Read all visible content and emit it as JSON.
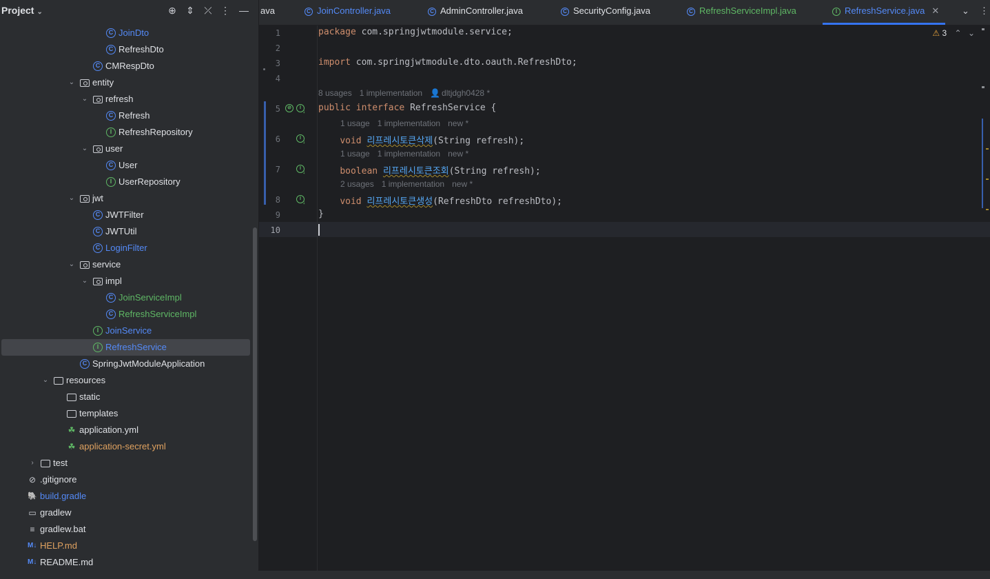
{
  "project": {
    "title": "Project",
    "tree": [
      {
        "label": "JoinDto",
        "icon": "class-icon",
        "color": "blue",
        "depth": 8
      },
      {
        "label": "RefreshDto",
        "icon": "class-icon",
        "color": "default",
        "depth": 8
      },
      {
        "label": "CMRespDto",
        "icon": "class-icon",
        "color": "default",
        "depth": 7
      },
      {
        "label": "entity",
        "icon": "package-icon",
        "color": "default",
        "depth": 6,
        "arrow": "open"
      },
      {
        "label": "refresh",
        "icon": "package-icon",
        "color": "default",
        "depth": 7,
        "arrow": "open"
      },
      {
        "label": "Refresh",
        "icon": "class-icon",
        "color": "default",
        "depth": 8
      },
      {
        "label": "RefreshRepository",
        "icon": "interface-icon",
        "color": "default",
        "depth": 8
      },
      {
        "label": "user",
        "icon": "package-icon",
        "color": "default",
        "depth": 7,
        "arrow": "open"
      },
      {
        "label": "User",
        "icon": "class-icon",
        "color": "default",
        "depth": 8
      },
      {
        "label": "UserRepository",
        "icon": "interface-icon",
        "color": "default",
        "depth": 8
      },
      {
        "label": "jwt",
        "icon": "package-icon",
        "color": "default",
        "depth": 6,
        "arrow": "open"
      },
      {
        "label": "JWTFilter",
        "icon": "class-icon",
        "color": "default",
        "depth": 7
      },
      {
        "label": "JWTUtil",
        "icon": "class-icon",
        "color": "default",
        "depth": 7
      },
      {
        "label": "LoginFilter",
        "icon": "class-icon",
        "color": "blue",
        "depth": 7
      },
      {
        "label": "service",
        "icon": "package-icon",
        "color": "default",
        "depth": 6,
        "arrow": "open"
      },
      {
        "label": "impl",
        "icon": "package-icon",
        "color": "default",
        "depth": 7,
        "arrow": "open"
      },
      {
        "label": "JoinServiceImpl",
        "icon": "class-icon",
        "color": "green",
        "depth": 8
      },
      {
        "label": "RefreshServiceImpl",
        "icon": "class-icon",
        "color": "green",
        "depth": 8
      },
      {
        "label": "JoinService",
        "icon": "interface-icon",
        "color": "blue",
        "depth": 7
      },
      {
        "label": "RefreshService",
        "icon": "interface-icon",
        "color": "blue",
        "depth": 7,
        "selected": true
      },
      {
        "label": "SpringJwtModuleApplication",
        "icon": "spring-boot-class-icon",
        "color": "default",
        "depth": 6
      },
      {
        "label": "resources",
        "icon": "resources-folder-icon",
        "color": "default",
        "depth": 4,
        "arrow": "open"
      },
      {
        "label": "static",
        "icon": "folder-icon",
        "color": "default",
        "depth": 5
      },
      {
        "label": "templates",
        "icon": "folder-icon",
        "color": "default",
        "depth": 5
      },
      {
        "label": "application.yml",
        "icon": "yaml-spring-icon",
        "color": "default",
        "depth": 5
      },
      {
        "label": "application-secret.yml",
        "icon": "yaml-spring-icon",
        "color": "orange",
        "depth": 5
      },
      {
        "label": "test",
        "icon": "test-folder-icon",
        "color": "default",
        "depth": 3,
        "arrow": "closed"
      },
      {
        "label": ".gitignore",
        "icon": "ignore-file-icon",
        "color": "default",
        "depth": 2
      },
      {
        "label": "build.gradle",
        "icon": "gradle-icon",
        "color": "blue",
        "depth": 2
      },
      {
        "label": "gradlew",
        "icon": "terminal-file-icon",
        "color": "default",
        "depth": 2
      },
      {
        "label": "gradlew.bat",
        "icon": "text-file-icon",
        "color": "default",
        "depth": 2
      },
      {
        "label": "HELP.md",
        "icon": "markdown-icon",
        "color": "orange",
        "depth": 2
      },
      {
        "label": "README.md",
        "icon": "markdown-icon",
        "color": "default",
        "depth": 2
      }
    ]
  },
  "tabs": [
    {
      "label": "ava",
      "color": "default",
      "icon": ""
    },
    {
      "label": "JoinController.java",
      "color": "blue",
      "icon": "class-icon"
    },
    {
      "label": "AdminController.java",
      "color": "default",
      "icon": "class-icon"
    },
    {
      "label": "SecurityConfig.java",
      "color": "default",
      "icon": "class-icon"
    },
    {
      "label": "RefreshServiceImpl.java",
      "color": "green",
      "icon": "class-icon"
    },
    {
      "label": "RefreshService.java",
      "color": "blue",
      "icon": "interface-icon",
      "active": true
    }
  ],
  "editor": {
    "warnings_count": "3",
    "line_numbers": [
      "1",
      "2",
      "3",
      "4",
      "5",
      "6",
      "7",
      "8",
      "9",
      "10"
    ],
    "code": {
      "l1_kw": "package",
      "l1_rest": " com.springjwtmodule.service;",
      "l3_kw": "import",
      "l3_rest": " com.springjwtmodule.dto.oauth.RefreshDto;",
      "l5_kw1": "public",
      "l5_kw2": "interface",
      "l5_rest": " RefreshService {",
      "l6_kw": "void",
      "l6_method": "리프레시토큰삭제",
      "l6_rest": "(String refresh);",
      "l7_kw": "boolean",
      "l7_method": "리프레시토큰조회",
      "l7_rest": "(String refresh);",
      "l8_kw": "void",
      "l8_method": "리프레시토큰생성",
      "l8_rest": "(RefreshDto refreshDto);",
      "l9": "}"
    },
    "hints": {
      "interface": {
        "usages": "8 usages",
        "impl": "1 implementation",
        "author": "dltjdgh0428 *"
      },
      "m1": {
        "usages": "1 usage",
        "impl": "1 implementation",
        "author": "new *"
      },
      "m2": {
        "usages": "1 usage",
        "impl": "1 implementation",
        "author": "new *"
      },
      "m3": {
        "usages": "2 usages",
        "impl": "1 implementation",
        "author": "new *"
      }
    }
  }
}
